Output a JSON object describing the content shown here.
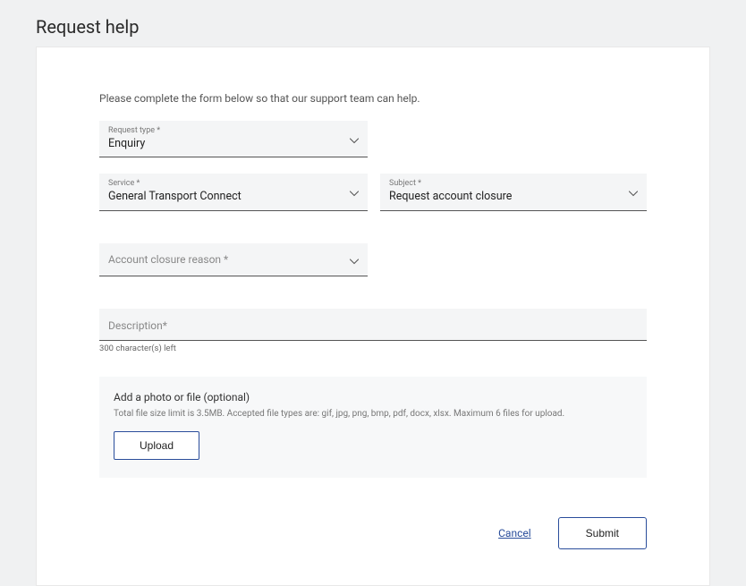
{
  "page": {
    "title": "Request help"
  },
  "form": {
    "intro": "Please complete the form below so that our support team can help.",
    "requestType": {
      "label": "Request type *",
      "value": "Enquiry"
    },
    "service": {
      "label": "Service *",
      "value": "General Transport Connect"
    },
    "subject": {
      "label": "Subject *",
      "value": "Request account closure"
    },
    "closureReason": {
      "placeholder": "Account closure reason *"
    },
    "description": {
      "placeholder": "Description*",
      "charCount": "300 character(s) left"
    },
    "upload": {
      "title": "Add a photo or file (optional)",
      "hint": "Total file size limit is 3.5MB. Accepted file types are: gif, jpg, png, bmp, pdf, docx, xlsx. Maximum 6 files for upload.",
      "button": "Upload"
    },
    "actions": {
      "cancel": "Cancel",
      "submit": "Submit"
    }
  }
}
